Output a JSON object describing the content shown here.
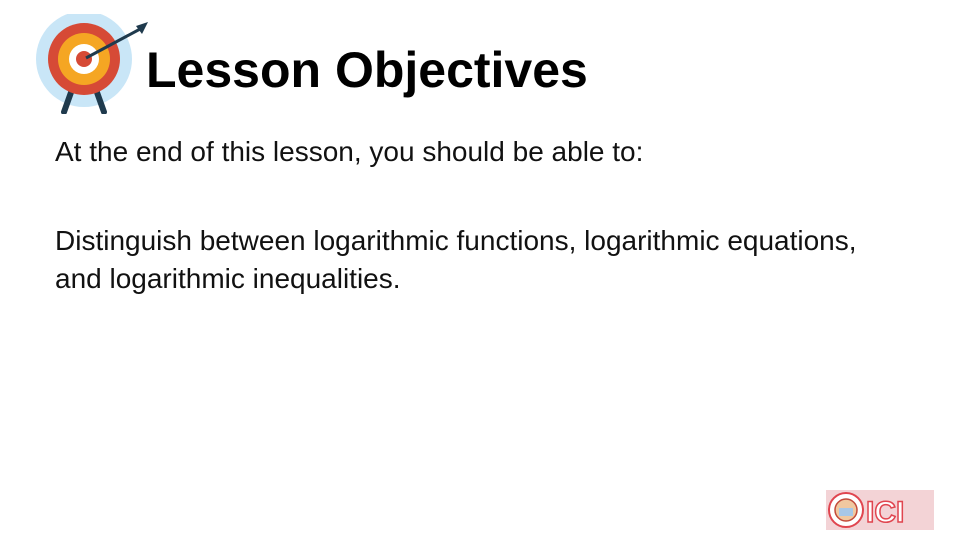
{
  "slide": {
    "title": "Lesson Objectives",
    "intro": "At the end of this lesson, you should be able to:",
    "objective": "Distinguish between logarithmic functions, logarithmic equations, and logarithmic inequalities."
  },
  "icons": {
    "header_icon": "target-arrow-icon",
    "logo": "ici-logo"
  },
  "logo_text": "ICI",
  "colors": {
    "target_outer": "#c9e6f7",
    "target_red": "#d64a36",
    "target_orange": "#f5a623",
    "arrow": "#1f3a4d",
    "logo_red": "#e0454f"
  }
}
